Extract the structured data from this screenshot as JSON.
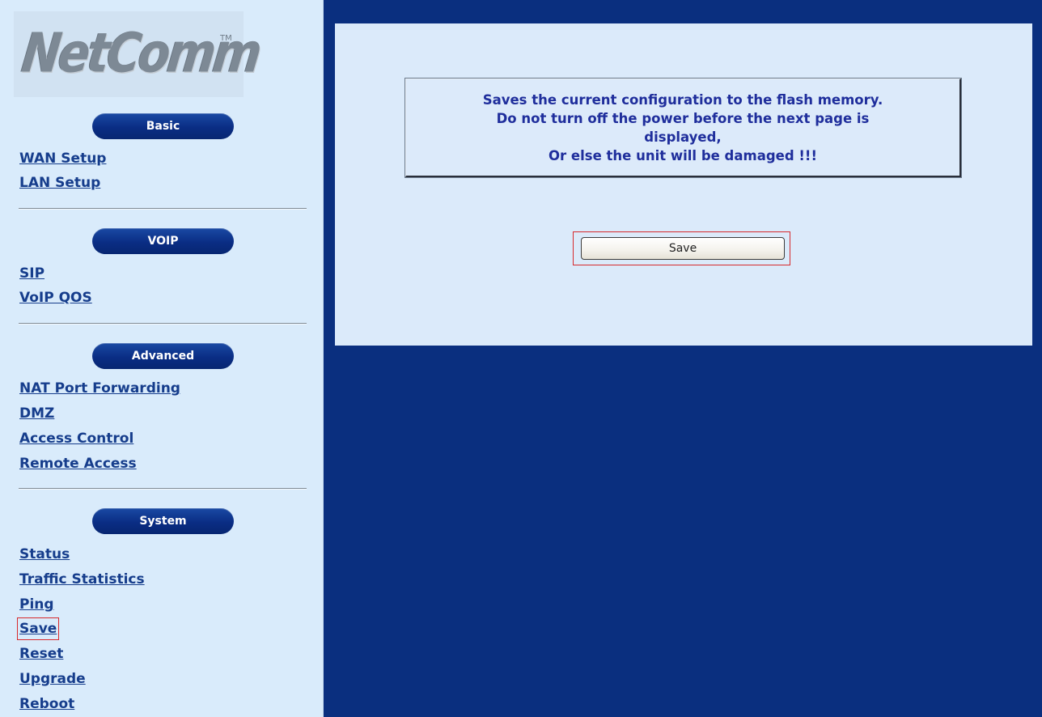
{
  "brand": {
    "logo_text": "NetComm",
    "trademark": "TM"
  },
  "sidebar": {
    "sections": [
      {
        "title": "Basic",
        "links": [
          "WAN Setup",
          "LAN Setup"
        ]
      },
      {
        "title": "VOIP",
        "links": [
          "SIP",
          "VoIP QOS"
        ]
      },
      {
        "title": "Advanced",
        "links": [
          "NAT Port Forwarding",
          "DMZ",
          "Access Control",
          "Remote Access"
        ]
      },
      {
        "title": "System",
        "links": [
          "Status",
          "Traffic Statistics",
          "Ping",
          "Save",
          "Reset",
          "Upgrade",
          "Reboot"
        ]
      }
    ],
    "active_link": "Save"
  },
  "main": {
    "notice_lines": [
      "Saves the current configuration to the flash memory.",
      "Do not turn off the power before the next page is",
      "displayed,",
      "Or else the unit will be damaged !!!"
    ],
    "save_button_label": "Save"
  },
  "colors": {
    "page_background": "#0a2f7f",
    "sidebar_background": "#d9ebfb",
    "panel_background": "#dbeafa",
    "link_color": "#163d8c",
    "notice_text_color": "#1f2e9c",
    "highlight_color": "#d7292c",
    "pill_color": "#0a2d84"
  }
}
